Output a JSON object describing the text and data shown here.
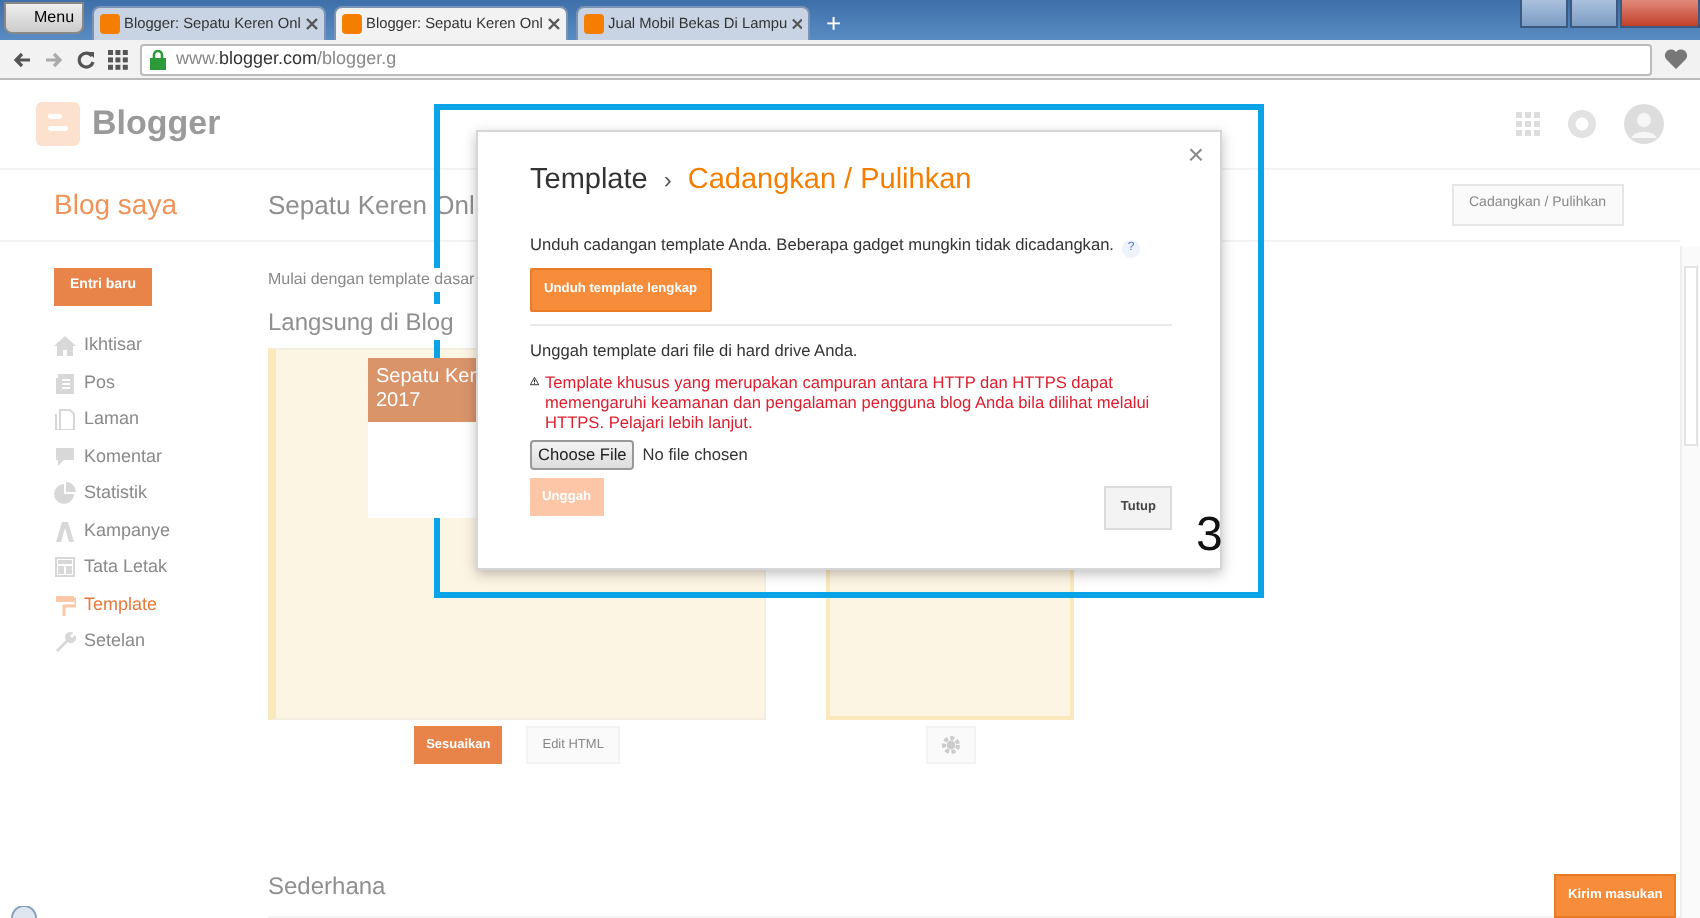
{
  "browser": {
    "menu_label": "Menu",
    "tabs": [
      {
        "title": "Blogger: Sepatu Keren Onl",
        "selected": false
      },
      {
        "title": "Blogger: Sepatu Keren Onl",
        "selected": true
      },
      {
        "title": "Jual Mobil Bekas Di Lampu",
        "selected": false
      }
    ],
    "new_tab": "+",
    "url": {
      "host_prefix": "www.",
      "domain": "blogger.com",
      "path": "/blogger.g"
    }
  },
  "header": {
    "logo_text": "Blogger"
  },
  "subheader": {
    "blog_list_label": "Blog saya",
    "blog_title": "Sepatu Keren Onl",
    "action_button": "Cadangkan / Pulihkan"
  },
  "sidebar": {
    "new_post_button": "Entri baru",
    "items": [
      {
        "label": "Ikhtisar",
        "selected": false
      },
      {
        "label": "Pos",
        "selected": false
      },
      {
        "label": "Laman",
        "selected": false
      },
      {
        "label": "Komentar",
        "selected": false
      },
      {
        "label": "Statistik",
        "selected": false
      },
      {
        "label": "Kampanye",
        "selected": false
      },
      {
        "label": "Tata Letak",
        "selected": false
      },
      {
        "label": "Template",
        "selected": true
      },
      {
        "label": "Setelan",
        "selected": false
      }
    ]
  },
  "main": {
    "intro": "Mulai dengan template dasar",
    "live_heading": "Langsung di Blog",
    "preview_title": [
      "Sepatu Ker",
      "2017"
    ],
    "buttons": [
      "Sesuaikan",
      "Edit HTML"
    ],
    "simple_heading": "Sederhana"
  },
  "dialog": {
    "title": "Template",
    "separator": "›",
    "subtitle": "Cadangkan / Pulihkan",
    "close": "×",
    "download_text": "Unduh cadangan template Anda. Beberapa gadget mungkin tidak dicadangkan.",
    "help": "?",
    "download_button": "Unduh template lengkap",
    "upload_text": "Unggah template dari file di hard drive Anda.",
    "warning": "Template khusus yang merupakan campuran antara HTTP dan HTTPS dapat memengaruhi keamanan dan pengalaman pengguna blog Anda bila dilihat melalui HTTPS.",
    "warning_link": "Pelajari lebih lanjut.",
    "file_button": "Choose File",
    "file_status": "No file chosen",
    "upload_button": {
      "label": "Unggah",
      "disabled": true
    },
    "close_button": "Tutup"
  },
  "annotation": "3",
  "feedback_button": "Kirim masukan"
}
